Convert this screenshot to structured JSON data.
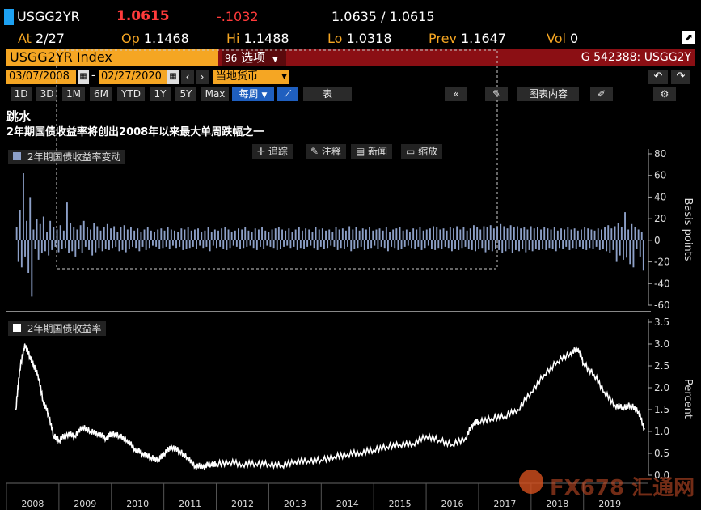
{
  "quote": {
    "ticker": "USGG2YR",
    "last": "1.0615",
    "change": "-.1032",
    "bid_ask": "1.0635 / 1.0615",
    "at_label": "At",
    "at_value": "2/27",
    "op_label": "Op",
    "op_value": "1.1468",
    "hi_label": "Hi",
    "hi_value": "1.1488",
    "lo_label": "Lo",
    "lo_value": "1.0318",
    "prev_label": "Prev",
    "prev_value": "1.1647",
    "vol_label": "Vol",
    "vol_value": "0"
  },
  "command_bar": {
    "security": "USGG2YR Index",
    "options_key": "96",
    "options_label": "选项",
    "function_code": "G 542388: USGG2Y"
  },
  "date_bar": {
    "start_date": "03/07/2008",
    "end_date": "02/27/2020",
    "currency": "当地货币"
  },
  "periods": [
    "1D",
    "3D",
    "1M",
    "6M",
    "YTD",
    "1Y",
    "5Y",
    "Max"
  ],
  "frequency": "每周",
  "table_label": "表",
  "chart_content_label": "图表内容",
  "chart_title": "跳水",
  "chart_subtitle": "2年期国债收益率将创出2008年以来最大单周跌幅之一",
  "chart_tools": {
    "track": "追踪",
    "annotate": "注释",
    "news": "新闻",
    "zoom": "缩放"
  },
  "watermark": "FX678 汇通网",
  "colors": {
    "accent_orange": "#f5a623",
    "brand_red": "#8b0f14",
    "change_red": "#ff3b3b",
    "bar_series": "#8da0c8",
    "line_series": "#ffffff"
  },
  "chart_data": [
    {
      "type": "bar",
      "legend": "2年期国债收益率变动",
      "ylabel": "Basis points",
      "ylim": [
        -60,
        80
      ],
      "yticks": [
        80,
        60,
        40,
        20,
        0,
        -20,
        -40,
        -60
      ],
      "frequency": "weekly",
      "x_start": "2008-03-07",
      "x_end": "2020-02-27",
      "values": [
        12,
        -20,
        28,
        -25,
        62,
        -15,
        18,
        -30,
        40,
        -52,
        10,
        -8,
        20,
        -18,
        15,
        -12,
        22,
        -10,
        8,
        -14,
        18,
        -9,
        12,
        -6,
        10,
        -11,
        14,
        -8,
        9,
        -7,
        35,
        -12,
        16,
        -10,
        12,
        -15,
        10,
        -8,
        14,
        -12,
        18,
        -6,
        12,
        -9,
        10,
        -14,
        16,
        -11,
        13,
        -7,
        9,
        -10,
        12,
        -8,
        15,
        -9,
        11,
        -7,
        13,
        -6,
        8,
        -10,
        12,
        -9,
        14,
        -11,
        10,
        -8,
        12,
        -6,
        9,
        -7,
        11,
        -10,
        8,
        -6,
        10,
        -9,
        12,
        -7,
        9,
        -5,
        8,
        -6,
        10,
        -8,
        11,
        -7,
        9,
        -6,
        12,
        -8,
        10,
        -5,
        9,
        -7,
        8,
        -6,
        11,
        -9,
        10,
        -8,
        12,
        -7,
        9,
        -6,
        10,
        -8,
        11,
        -5,
        8,
        -7,
        9,
        -6,
        12,
        -10,
        8,
        -5,
        10,
        -7,
        9,
        -6,
        11,
        -8,
        12,
        -9,
        10,
        -7,
        8,
        -5,
        9,
        -6,
        11,
        -8,
        10,
        -7,
        12,
        -6,
        9,
        -5,
        8,
        -7,
        11,
        -9,
        10,
        -6,
        12,
        -8,
        9,
        -5,
        8,
        -6,
        10,
        -7,
        11,
        -9,
        12,
        -8,
        10,
        -6,
        9,
        -5,
        11,
        -7,
        8,
        -6,
        10,
        -9,
        12,
        -7,
        9,
        -8,
        11,
        -6,
        10,
        -5,
        8,
        -7,
        12,
        -9,
        10,
        -6,
        11,
        -8,
        9,
        -7,
        10,
        -5,
        8,
        -6,
        12,
        -9,
        10,
        -7,
        11,
        -8,
        9,
        -6,
        13,
        -10,
        10,
        -8,
        12,
        -7,
        9,
        -6,
        11,
        -9,
        10,
        -8,
        12,
        -7,
        9,
        -5,
        10,
        -8,
        11,
        -6,
        9,
        -7,
        12,
        -10,
        8,
        -6,
        10,
        -7,
        11,
        -9,
        12,
        -8,
        9,
        -6,
        10,
        -5,
        8,
        -7,
        11,
        -8,
        10,
        -6,
        12,
        -9,
        9,
        -7,
        10,
        -5,
        11,
        -8,
        13,
        -9,
        12,
        -7,
        10,
        -8,
        11,
        -6,
        9,
        -7,
        12,
        -10,
        11,
        -8,
        13,
        -9,
        10,
        -7,
        12,
        -6,
        9,
        -8,
        11,
        -9,
        14,
        -10,
        12,
        -8,
        10,
        -7,
        13,
        -11,
        12,
        -9,
        14,
        -10,
        11,
        -8,
        12,
        -9,
        15,
        -12,
        13,
        -10,
        11,
        -8,
        14,
        -12,
        12,
        -9,
        13,
        -10,
        11,
        -8,
        12,
        -11,
        10,
        -9,
        13,
        -10,
        11,
        -8,
        12,
        -9,
        10,
        -8,
        12,
        -9,
        11,
        -7,
        10,
        -8,
        12,
        -10,
        9,
        -7,
        11,
        -8,
        10,
        -6,
        12,
        -9,
        10,
        -7,
        11,
        -8,
        9,
        -6,
        10,
        -8,
        12,
        -9,
        11,
        -7,
        10,
        -8,
        9,
        -6,
        11,
        -9,
        10,
        -8,
        12,
        -10,
        14,
        -12,
        11,
        -9,
        13,
        -20,
        16,
        -14,
        12,
        -18,
        26,
        -16,
        10,
        -22,
        15,
        -25,
        12,
        -8,
        10,
        -15,
        8,
        -28
      ]
    },
    {
      "type": "line",
      "legend": "2年期国债收益率",
      "ylabel": "Percent",
      "ylim": [
        0,
        3.5
      ],
      "yticks": [
        3.5,
        3.0,
        2.5,
        2.0,
        1.5,
        1.0,
        0.5,
        0.0
      ],
      "x_tick_labels": [
        "2008",
        "2009",
        "2010",
        "2011",
        "2012",
        "2013",
        "2014",
        "2015",
        "2016",
        "2017",
        "2018",
        "2019"
      ],
      "x": [
        2008.18,
        2008.25,
        2008.35,
        2008.45,
        2008.52,
        2008.6,
        2008.7,
        2008.8,
        2008.9,
        2009.0,
        2009.15,
        2009.3,
        2009.45,
        2009.6,
        2009.75,
        2009.9,
        2010.0,
        2010.15,
        2010.3,
        2010.45,
        2010.6,
        2010.75,
        2010.9,
        2011.0,
        2011.15,
        2011.3,
        2011.45,
        2011.6,
        2011.75,
        2011.9,
        2012.0,
        2012.25,
        2012.5,
        2012.75,
        2013.0,
        2013.25,
        2013.5,
        2013.75,
        2014.0,
        2014.25,
        2014.5,
        2014.75,
        2015.0,
        2015.25,
        2015.5,
        2015.75,
        2016.0,
        2016.25,
        2016.5,
        2016.75,
        2016.9,
        2017.0,
        2017.25,
        2017.5,
        2017.75,
        2018.0,
        2018.25,
        2018.5,
        2018.75,
        2018.9,
        2019.0,
        2019.2,
        2019.4,
        2019.6,
        2019.75,
        2019.9,
        2020.05,
        2020.16
      ],
      "values": [
        1.5,
        2.4,
        3.0,
        2.7,
        2.5,
        2.3,
        1.7,
        1.4,
        0.9,
        0.8,
        0.95,
        0.9,
        1.1,
        1.0,
        0.95,
        0.85,
        0.95,
        0.9,
        0.8,
        0.6,
        0.5,
        0.4,
        0.35,
        0.5,
        0.65,
        0.55,
        0.4,
        0.2,
        0.22,
        0.25,
        0.25,
        0.3,
        0.25,
        0.27,
        0.25,
        0.22,
        0.32,
        0.33,
        0.35,
        0.42,
        0.48,
        0.52,
        0.58,
        0.65,
        0.7,
        0.72,
        0.9,
        0.8,
        0.7,
        0.85,
        1.2,
        1.22,
        1.3,
        1.35,
        1.5,
        1.9,
        2.3,
        2.6,
        2.8,
        2.9,
        2.55,
        2.3,
        1.9,
        1.6,
        1.55,
        1.6,
        1.45,
        1.06
      ]
    }
  ]
}
